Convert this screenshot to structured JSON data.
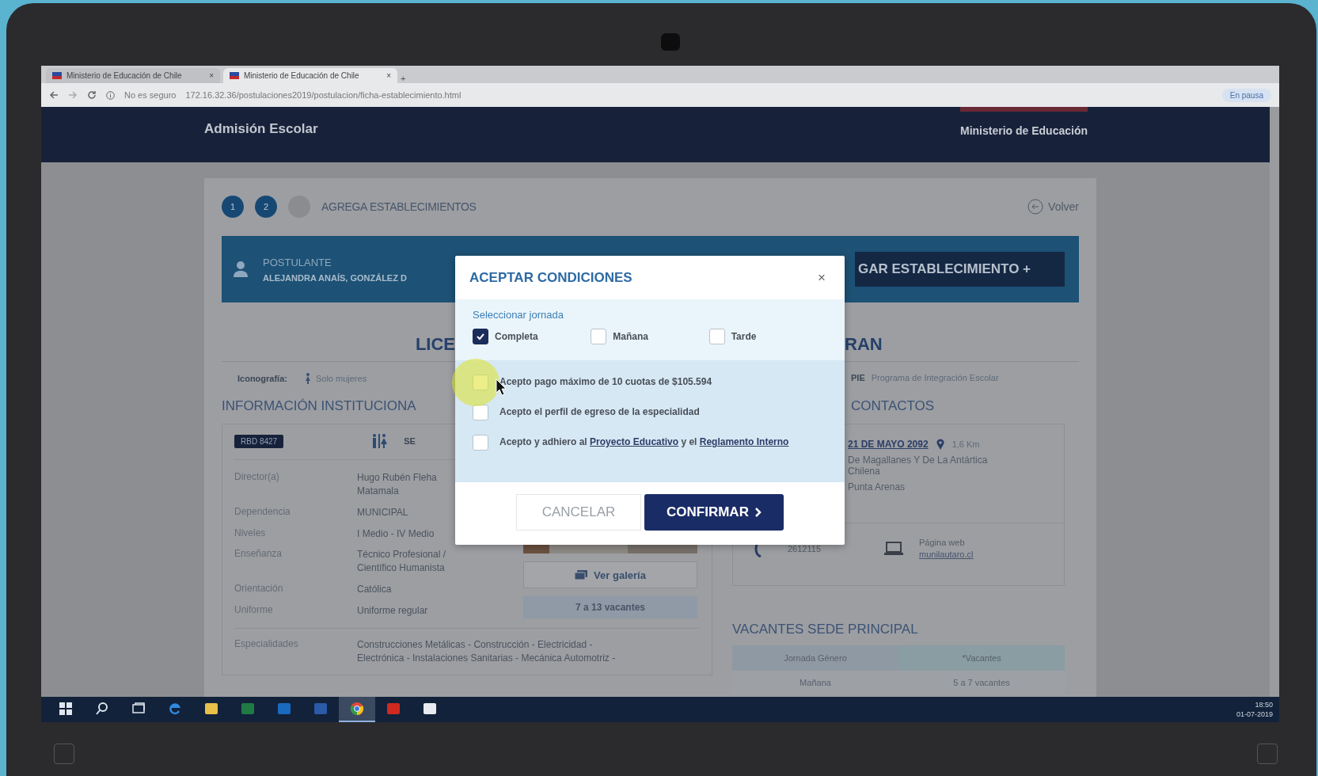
{
  "browser": {
    "tabs": [
      {
        "label": "Ministerio de Educación de Chile",
        "close": "×",
        "selected": false
      },
      {
        "label": "Ministerio de Educación de Chile",
        "close": "×",
        "selected": true
      }
    ],
    "new_tab": "+",
    "security": "No es seguro",
    "url": "172.16.32.36/postulaciones2019/postulacion/ficha-establecimiento.html",
    "profile": "En pausa"
  },
  "header": {
    "logo": "Admisión Escolar",
    "ministry": "Ministerio de Educación"
  },
  "steps": [
    {
      "label": "1",
      "done": true
    },
    {
      "label": "2",
      "done": true
    },
    {
      "done": false
    }
  ],
  "step_title": "AGREGA ESTABLECIMIENTOS",
  "back": "Volver",
  "applicant": {
    "label": "POSTULANTE",
    "name": "ALEJANDRA ANAÍS, GONZÁLEZ D",
    "add_button": "GAR ESTABLECIMIENTO +"
  },
  "school_title": {
    "left": "LICE",
    "right": "RAN"
  },
  "iconography": {
    "label": "Iconografía:",
    "items": [
      {
        "text": "Solo mujeres"
      }
    ],
    "pie": {
      "badge": "PIE",
      "text": "Programa de Integración Escolar"
    }
  },
  "info": {
    "title": "INFORMACIÓN INSTITUCIONA",
    "rbd": "RBD 8427",
    "tag": "SE",
    "rows": [
      {
        "label": "Director(a)",
        "lines": [
          "Hugo Rubén Fleha",
          "Matamala"
        ]
      },
      {
        "label": "Dependencia",
        "lines": [
          "MUNICIPAL"
        ]
      },
      {
        "label": "Niveles",
        "lines": [
          "I Medio - IV Medio"
        ]
      },
      {
        "label": "Enseñanza",
        "lines": [
          "Técnico Profesional /",
          "Científico Humanista"
        ]
      },
      {
        "label": "Orientación",
        "lines": [
          "Católica"
        ]
      },
      {
        "label": "Uniforme",
        "lines": [
          "Uniforme regular"
        ]
      }
    ],
    "specialties": {
      "label": "Especialidades",
      "lines": [
        "Construcciones Metálicas - Construcción - Electricidad -",
        "Electrónica - Instalaciones Sanitarias - Mecánica Automotriz -"
      ]
    },
    "gallery": "Ver galería",
    "vacancies": "7 a 13 vacantes"
  },
  "contacts": {
    "title": "CONTACTOS",
    "address": "21 DE MAYO 2092",
    "distance": "1,6 Km",
    "region": "De Magallanes Y De La Antártica Chilena",
    "city": "Punta Arenas",
    "phone": "2612115",
    "web_label": "Página web",
    "web": "munilautaro.cl"
  },
  "vacancies": {
    "title": "VACANTES SEDE PRINCIPAL",
    "columns": [
      "Jornada Género",
      "*Vacantes"
    ],
    "rows": [
      [
        "Mañana",
        "5 a 7 vacantes"
      ]
    ]
  },
  "modal": {
    "title": "ACEPTAR CONDICIONES",
    "close": "×",
    "jornada_label": "Seleccionar jornada",
    "jornadas": [
      {
        "label": "Completa",
        "checked": true
      },
      {
        "label": "Mañana",
        "checked": false
      },
      {
        "label": "Tarde",
        "checked": false
      }
    ],
    "conditions": [
      {
        "checked": false,
        "parts": [
          {
            "kind": "text",
            "text": "Acepto pago máximo de 10 cuotas de $105.594"
          }
        ]
      },
      {
        "checked": false,
        "parts": [
          {
            "kind": "text",
            "text": "Acepto el perfil de egreso de la especialidad"
          }
        ]
      },
      {
        "checked": false,
        "parts": [
          {
            "kind": "text",
            "text": "Acepto y adhiero al "
          },
          {
            "kind": "link",
            "text": "Proyecto Educativo"
          },
          {
            "kind": "text",
            "text": " y el "
          },
          {
            "kind": "link",
            "text": "Reglamento Interno"
          }
        ]
      }
    ],
    "cancel": "CANCELAR",
    "confirm": "CONFIRMAR"
  },
  "taskbar": {
    "apps": [
      {
        "kind": "start",
        "selected": false
      },
      {
        "kind": "search",
        "selected": false
      },
      {
        "kind": "taskview",
        "selected": false
      },
      {
        "kind": "edge",
        "selected": false
      },
      {
        "kind": "folder",
        "selected": false
      },
      {
        "kind": "excel",
        "selected": false
      },
      {
        "kind": "outlook",
        "selected": false
      },
      {
        "kind": "word",
        "selected": false
      },
      {
        "kind": "chrome",
        "selected": true
      },
      {
        "kind": "pdf",
        "selected": false
      },
      {
        "kind": "window",
        "selected": false
      }
    ],
    "time": "18:50",
    "date": "01-07-2019"
  }
}
